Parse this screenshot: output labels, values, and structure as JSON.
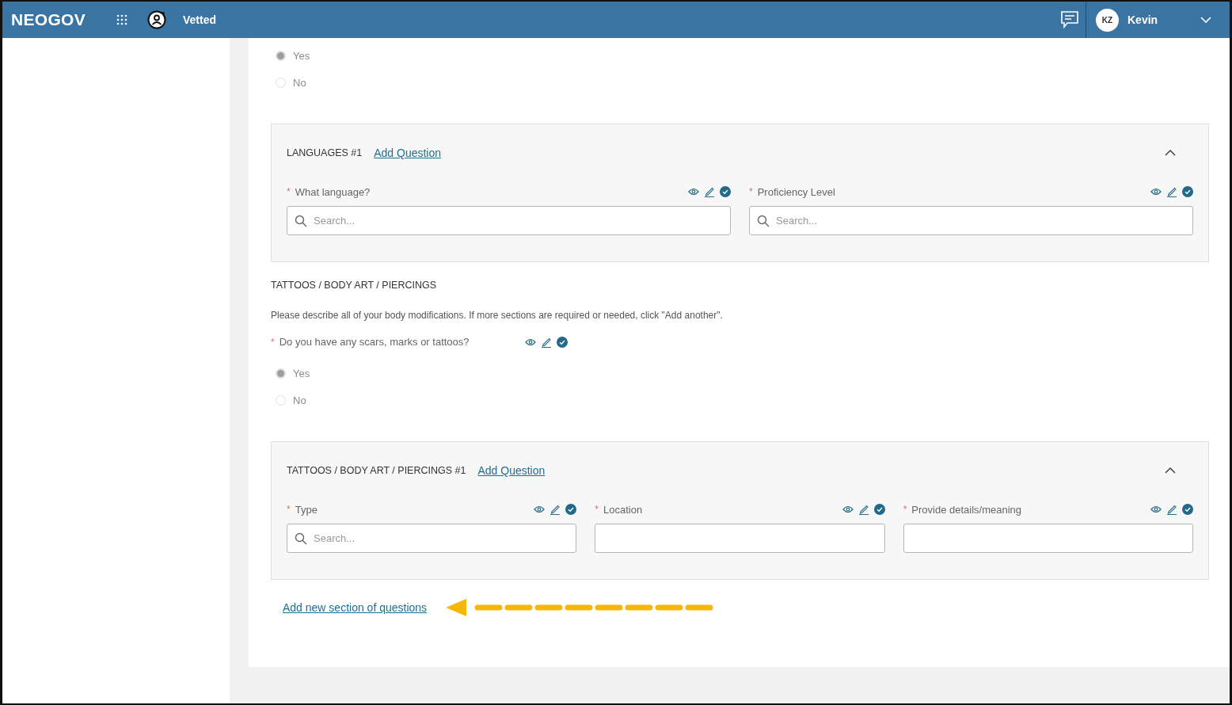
{
  "header": {
    "logo": "NEOGOV",
    "app_name": "Vetted",
    "user": {
      "initials": "KZ",
      "name": "Kevin"
    }
  },
  "blocks": [
    {
      "kind": "radios",
      "options": [
        {
          "label": "Yes",
          "selected": true
        },
        {
          "label": "No",
          "selected": false
        }
      ]
    },
    {
      "kind": "group",
      "title": "LANGUAGES #1",
      "add_question": "Add Question",
      "expanded": true,
      "fields": [
        {
          "mark": "*",
          "label": "What language?",
          "kind": "search",
          "placeholder": "Search..."
        },
        {
          "mark": "*",
          "label": "Proficiency Level",
          "kind": "search",
          "placeholder": "Search..."
        }
      ]
    },
    {
      "kind": "heading",
      "text": "TATTOOS / BODY ART / PIERCINGS"
    },
    {
      "kind": "description",
      "text": "Please describe all of your body modifications. If more sections are required or needed, click \"Add another\"."
    },
    {
      "kind": "question",
      "mark": "*",
      "label": "Do you have any scars, marks or tattoos?"
    },
    {
      "kind": "radios",
      "options": [
        {
          "label": "Yes",
          "selected": true
        },
        {
          "label": "No",
          "selected": false
        }
      ]
    },
    {
      "kind": "group",
      "title": "TATTOOS / BODY ART / PIERCINGS #1",
      "add_question": "Add Question",
      "expanded": true,
      "fields": [
        {
          "mark": "*",
          "label": "Type",
          "kind": "search",
          "placeholder": "Search..."
        },
        {
          "mark": "*",
          "label": "Location",
          "kind": "text"
        },
        {
          "mark": "*",
          "label": "Provide details/meaning",
          "kind": "text"
        }
      ]
    }
  ],
  "add_section": "Add new section of questions"
}
